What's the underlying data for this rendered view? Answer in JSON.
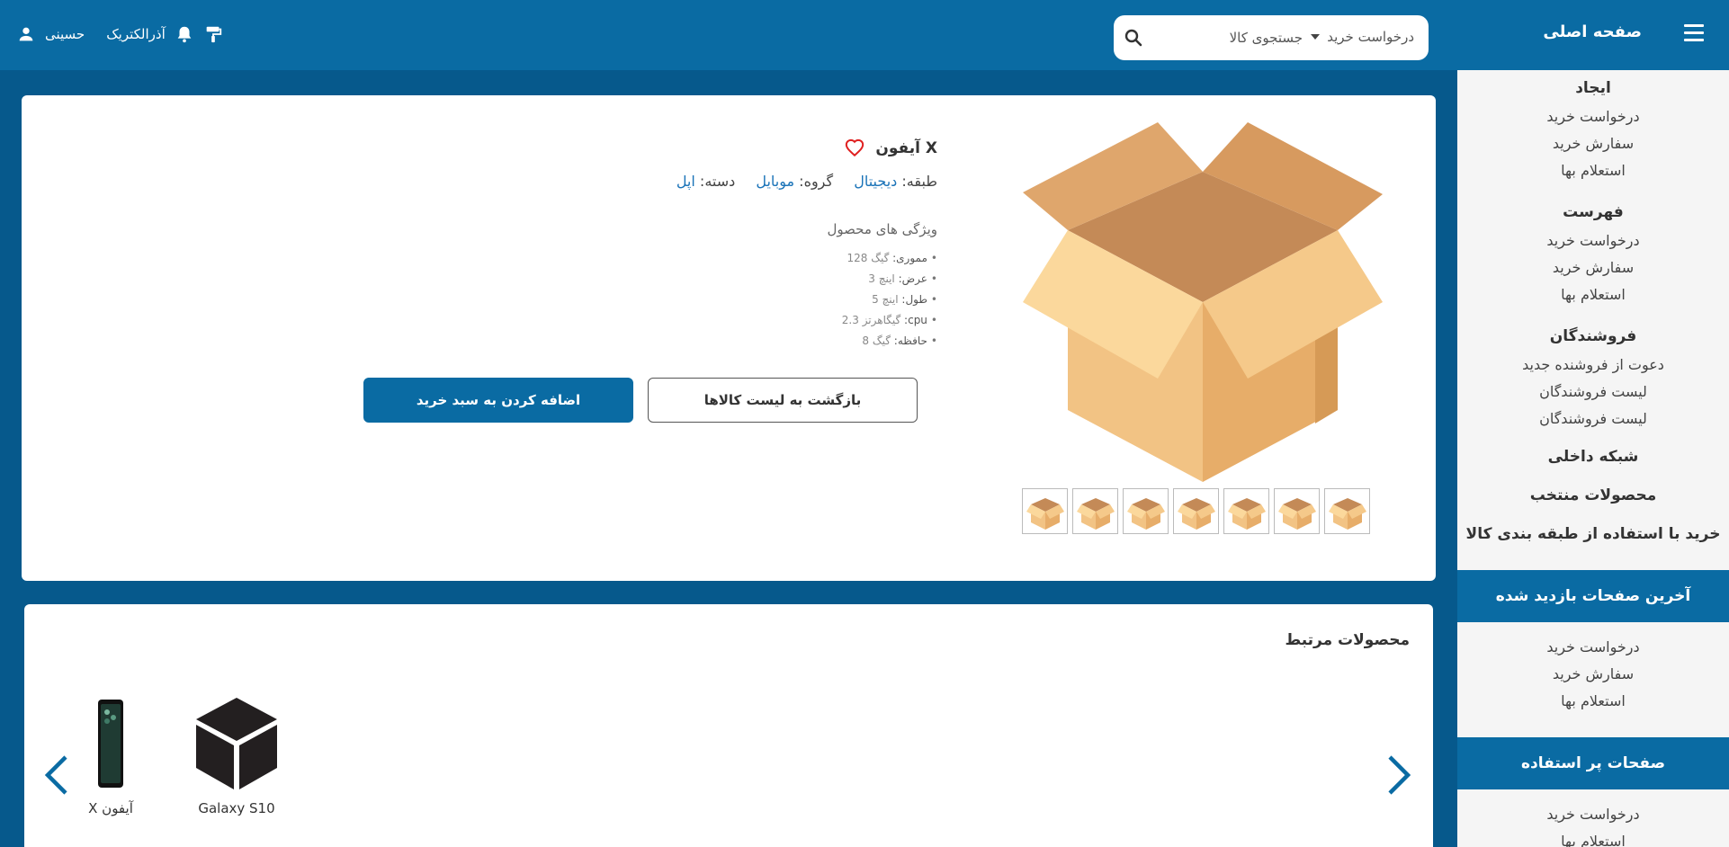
{
  "header": {
    "home_title": "صفحه اصلی",
    "search_category": "درخواست خرید",
    "search_placeholder": "جستجوی کالا",
    "company_name": "آذرالکتریک",
    "user_name": "حسینی",
    "icons": [
      "menu-icon",
      "search-icon",
      "paint-roller-icon",
      "bell-icon",
      "user-icon"
    ]
  },
  "sidebar": {
    "sections": [
      {
        "title": "ایجاد",
        "items": [
          "درخواست خرید",
          "سفارش خرید",
          "استعلام بها"
        ]
      },
      {
        "title": "فهرست",
        "items": [
          "درخواست خرید",
          "سفارش خرید",
          "استعلام بها"
        ]
      },
      {
        "title": "فروشندگان",
        "items": [
          "دعوت از فروشنده جدید",
          "لیست فروشندگان",
          "لیست فروشندگان"
        ]
      }
    ],
    "links": [
      "شبکه داخلی",
      "محصولات منتخب",
      "خرید با استفاده از طبقه بندی کالا"
    ],
    "recent": {
      "title": "آخرین صفحات بازدید شده",
      "items": [
        "درخواست خرید",
        "سفارش خرید",
        "استعلام بها"
      ]
    },
    "popular": {
      "title": "صفحات پر استفاده",
      "items": [
        "درخواست خرید",
        "استعلام بها"
      ]
    }
  },
  "product": {
    "title": "X آیفون",
    "class_label": "طبقه:",
    "class_value": "دیجیتال",
    "group_label": "گروه:",
    "group_value": "موبایل",
    "category_label": "دسته:",
    "category_value": "اپل",
    "features_title": "ویژگی های محصول",
    "features": [
      {
        "key": "مموری:",
        "value": "گیگ 128"
      },
      {
        "key": "عرض:",
        "value": "اینچ 3"
      },
      {
        "key": "طول:",
        "value": "اینچ 5"
      },
      {
        "key": "cpu:",
        "value": "گیگاهرتز 2.3"
      },
      {
        "key": "حافظه:",
        "value": "گیگ 8"
      }
    ],
    "thumbnail_count": 7,
    "back_button": "بازگشت به لیست کالاها",
    "add_button": "اضافه کردن به سبد خرید"
  },
  "related": {
    "title": "محصولات مرتبط",
    "items": [
      {
        "name": "Galaxy S10",
        "icon": "box-3d-icon"
      },
      {
        "name": "X آیفون",
        "icon": "phone-image"
      }
    ]
  },
  "colors": {
    "header_bg": "#0a6ba3",
    "page_bg": "#06598c",
    "accent": "#0a6ba3",
    "link": "#1a73b8",
    "heart": "#e02020"
  }
}
